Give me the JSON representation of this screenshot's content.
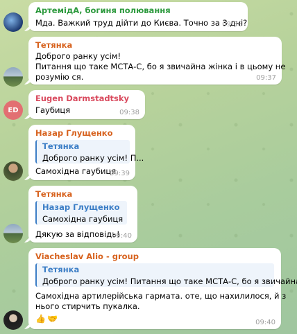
{
  "messages": [
    {
      "author": "АртемідА, богиня полювання",
      "author_color": "#2d9a3e",
      "lines": [
        "Мда. Важкий труд дійти до Києва. Точно за 3 дні?"
      ],
      "time": "09:36",
      "avatar": "planet-avatar"
    },
    {
      "author": "Тетянка",
      "author_color": "#d7621e",
      "lines": [
        "Доброго ранку усім!",
        "Питання що таке МСТА-С, бо я звичайна жінка і в цьому не",
        "розумію ся."
      ],
      "time": "09:37",
      "avatar": "landscape-avatar"
    },
    {
      "author": "Eugen Darmstadtsky",
      "author_color": "#d94a5e",
      "lines": [
        "Гаубиця"
      ],
      "time": "09:38",
      "avatar_initials": "ED",
      "avatar_color": "#e26f72"
    },
    {
      "author": "Назар Глущенко",
      "author_color": "#d7621e",
      "reply_name": "Тетянка",
      "reply_text": "Доброго ранку усім! П...",
      "lines": [
        "Самохідна гаубиця"
      ],
      "time": "09:39",
      "avatar": "person-avatar"
    },
    {
      "author": "Тетянка",
      "author_color": "#d7621e",
      "reply_name": "Назар Глущенко",
      "reply_text": "Самохідна гаубиця",
      "lines": [
        "Дякую за відповідь!"
      ],
      "time": "09:40",
      "avatar": "landscape-avatar"
    },
    {
      "author": "Viacheslav Alio - group",
      "author_color": "#d7621e",
      "reply_name": "Тетянка",
      "reply_text": "Доброго ранку усім! Питання що таке МСТА-С, бо я звичайна ...",
      "lines": [
        "Самохідна артилерійська гармата. оте, що нахилилося, й з",
        "нього стирчить пукалка."
      ],
      "reactions": [
        "👍",
        "🤝"
      ],
      "time": "09:40",
      "avatar": "dark-person-avatar"
    }
  ]
}
